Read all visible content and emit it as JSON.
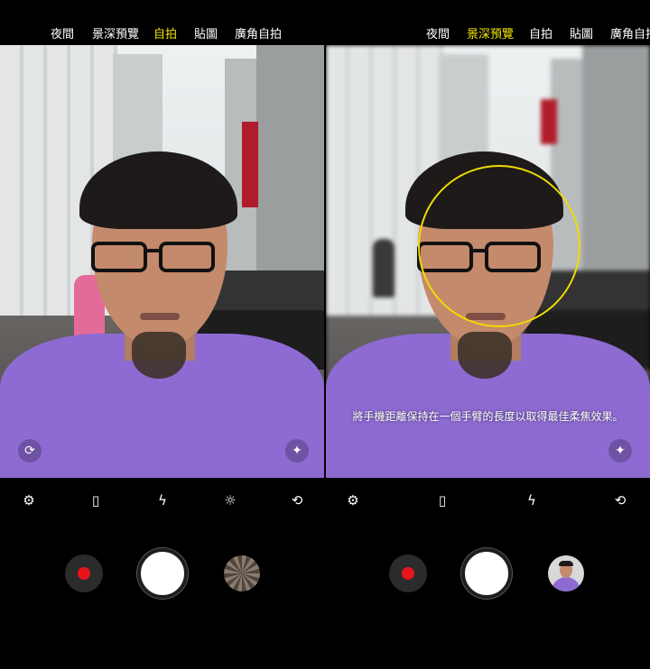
{
  "left_panel": {
    "modes": [
      {
        "label": "夜間",
        "active": false
      },
      {
        "label": "景深預覽",
        "active": false
      },
      {
        "label": "自拍",
        "active": true
      },
      {
        "label": "貼圖",
        "active": false
      },
      {
        "label": "廣角自拍",
        "active": false
      }
    ]
  },
  "right_panel": {
    "modes": [
      {
        "label": "夜間",
        "active": false
      },
      {
        "label": "景深預覽",
        "active": true
      },
      {
        "label": "自拍",
        "active": false
      },
      {
        "label": "貼圖",
        "active": false
      },
      {
        "label": "廣角自拍",
        "active": false
      }
    ],
    "hint": "將手機距離保持在一個手臂的長度以取得最佳柔焦效果。"
  },
  "toolbar_icons": [
    "gear-icon",
    "aspect-ratio-icon",
    "flash-off-icon",
    "brightness-icon",
    "switch-camera-icon"
  ],
  "colors": {
    "active_mode": "#f3e400",
    "record_dot": "#e8141c",
    "focus_ring": "#f0dc00"
  }
}
